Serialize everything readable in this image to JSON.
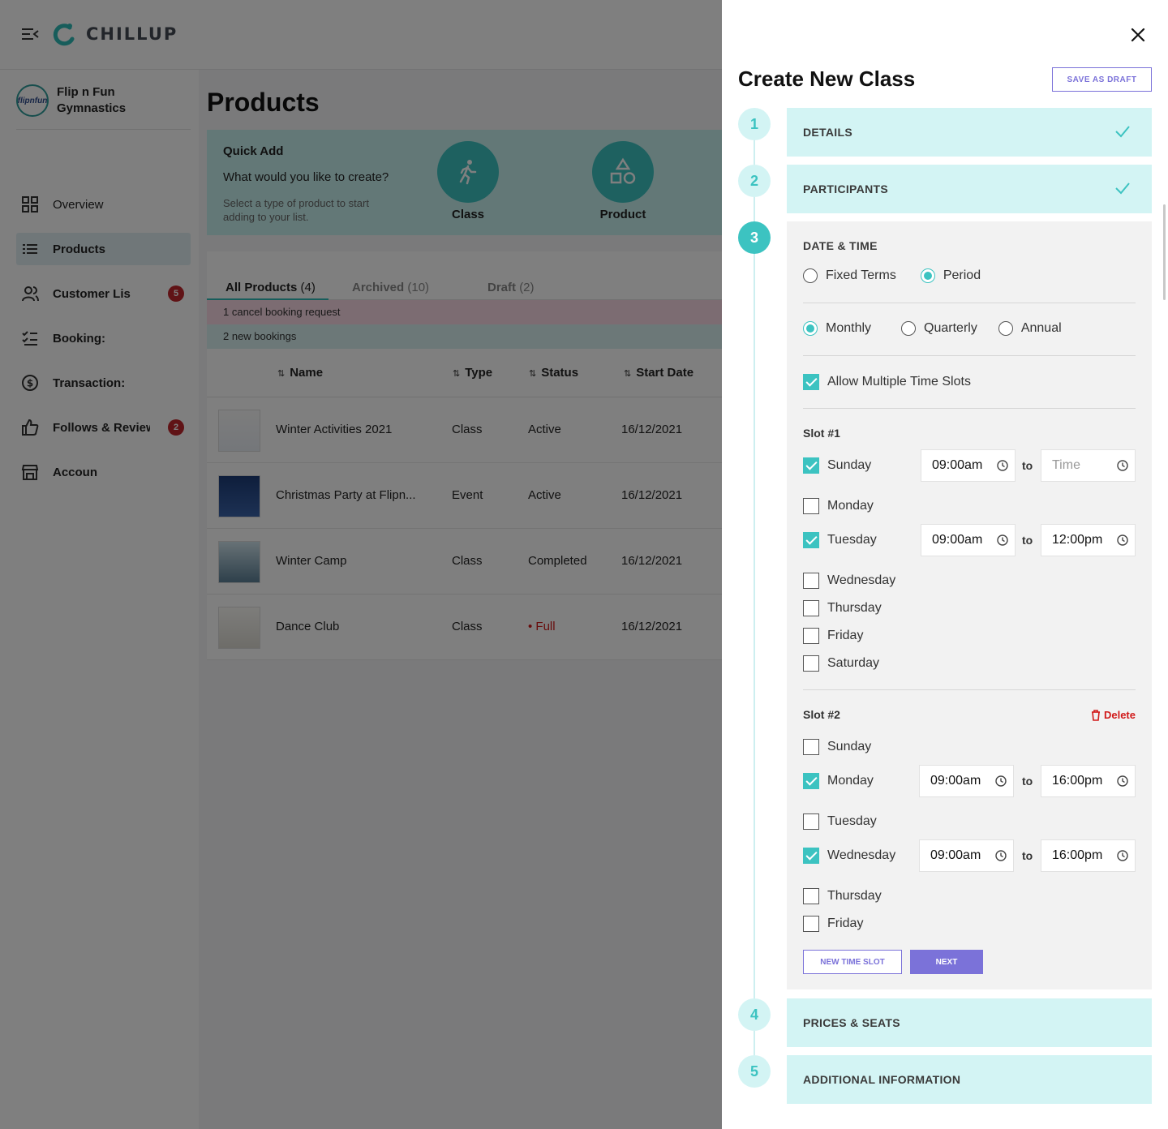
{
  "app": {
    "brand": "CHILLUP"
  },
  "org": {
    "name": "Flip n Fun Gymnastics",
    "avatar_text": "flipnfun"
  },
  "sidebar": {
    "items": [
      {
        "label": "Overview",
        "icon": "grid-icon",
        "badge": ""
      },
      {
        "label": "Products",
        "icon": "list-icon",
        "badge": ""
      },
      {
        "label": "Customer Lis",
        "icon": "users-icon",
        "badge": "5"
      },
      {
        "label": "Booking:",
        "icon": "checklist-icon",
        "badge": ""
      },
      {
        "label": "Transaction:",
        "icon": "dollar-icon",
        "badge": ""
      },
      {
        "label": "Follows & Review",
        "icon": "thumbs-up-icon",
        "badge": "2"
      },
      {
        "label": "Accoun",
        "icon": "store-icon",
        "badge": ""
      }
    ]
  },
  "page": {
    "title": "Products"
  },
  "quick_add": {
    "title": "Quick Add",
    "question": "What would you like to create?",
    "hint": "Select a type of product to start adding to your list.",
    "options": [
      {
        "label": "Class",
        "icon": "running-icon"
      },
      {
        "label": "Product",
        "icon": "shapes-icon"
      }
    ]
  },
  "tabs": [
    {
      "label": "All Products",
      "count": "(4)"
    },
    {
      "label": "Archived",
      "count": "(10)"
    },
    {
      "label": "Draft",
      "count": "(2)"
    }
  ],
  "notices": {
    "cancel": "1 cancel booking request",
    "new": "2 new bookings"
  },
  "table": {
    "columns": [
      "Name",
      "Type",
      "Status",
      "Start Date"
    ],
    "rows": [
      {
        "name": "Winter Activities 2021",
        "type": "Class",
        "status": "Active",
        "start": "16/12/2021"
      },
      {
        "name": "Christmas Party at Flipn...",
        "type": "Event",
        "status": "Active",
        "start": "16/12/2021"
      },
      {
        "name": "Winter Camp",
        "type": "Class",
        "status": "Completed",
        "start": "16/12/2021"
      },
      {
        "name": "Dance Club",
        "type": "Class",
        "status": "• Full",
        "start": "16/12/2021"
      }
    ]
  },
  "drawer": {
    "title": "Create New Class",
    "save_draft": "SAVE AS DRAFT",
    "steps": [
      {
        "num": "1",
        "label": "DETAILS",
        "done": true
      },
      {
        "num": "2",
        "label": "PARTICIPANTS",
        "done": true
      },
      {
        "num": "3",
        "label": "DATE & TIME",
        "done": false
      },
      {
        "num": "4",
        "label": "PRICES & SEATS",
        "done": false
      },
      {
        "num": "5",
        "label": "ADDITIONAL INFORMATION",
        "done": false
      }
    ],
    "date_time": {
      "schedule_types": [
        {
          "label": "Fixed Terms",
          "selected": false
        },
        {
          "label": "Period",
          "selected": true
        }
      ],
      "periods": [
        {
          "label": "Monthly",
          "selected": true
        },
        {
          "label": "Quarterly",
          "selected": false
        },
        {
          "label": "Annual",
          "selected": false
        }
      ],
      "allow_multiple": {
        "label": "Allow Multiple Time Slots",
        "checked": true
      },
      "to_label": "to",
      "time_placeholder": "Time",
      "delete_label": "Delete",
      "slots": [
        {
          "title": "Slot #1",
          "days": [
            {
              "day": "Sunday",
              "checked": true,
              "from": "09:00am",
              "to": ""
            },
            {
              "day": "Monday",
              "checked": false
            },
            {
              "day": "Tuesday",
              "checked": true,
              "from": "09:00am",
              "to": "12:00pm"
            },
            {
              "day": "Wednesday",
              "checked": false
            },
            {
              "day": "Thursday",
              "checked": false
            },
            {
              "day": "Friday",
              "checked": false
            },
            {
              "day": "Saturday",
              "checked": false
            }
          ]
        },
        {
          "title": "Slot #2",
          "days": [
            {
              "day": "Sunday",
              "checked": false
            },
            {
              "day": "Monday",
              "checked": true,
              "from": "09:00am",
              "to": "16:00pm"
            },
            {
              "day": "Tuesday",
              "checked": false
            },
            {
              "day": "Wednesday",
              "checked": true,
              "from": "09:00am",
              "to": "16:00pm"
            },
            {
              "day": "Thursday",
              "checked": false
            },
            {
              "day": "Friday",
              "checked": false
            }
          ]
        }
      ],
      "new_slot_label": "NEW TIME SLOT",
      "next_label": "NEXT"
    }
  },
  "colors": {
    "accent": "#3cc3c1",
    "step_bg": "#d3f4f4",
    "primary_button": "#7b72d9",
    "danger": "#d11a1a"
  }
}
